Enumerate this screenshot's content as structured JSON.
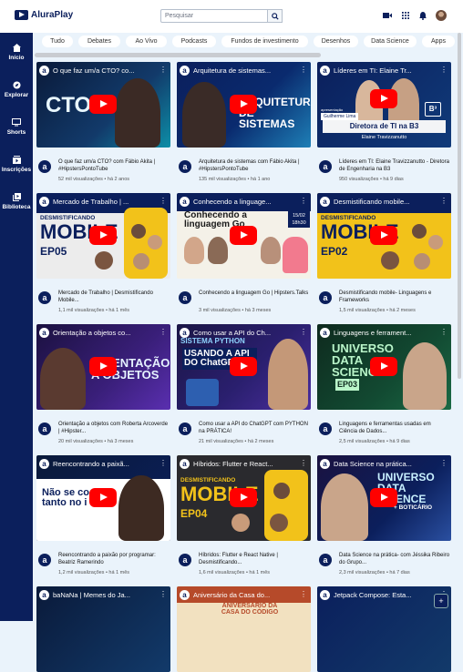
{
  "header": {
    "logo": "AluraPlay",
    "search_placeholder": "Pesquisar"
  },
  "sidebar": {
    "items": [
      {
        "label": "Início",
        "icon": "home-icon"
      },
      {
        "label": "Explorar",
        "icon": "compass-icon"
      },
      {
        "label": "Shorts",
        "icon": "monitor-icon"
      },
      {
        "label": "Inscrições",
        "icon": "subscriptions-icon"
      },
      {
        "label": "Biblioteca",
        "icon": "library-icon"
      }
    ]
  },
  "chips": [
    "Tudo",
    "Debates",
    "Ao Vivo",
    "Podcasts",
    "Fundos de investimento",
    "Desenhos",
    "Data Science",
    "Apps"
  ],
  "videos": [
    {
      "thumb_title": "O que faz um/a CTO? co...",
      "title": "O que faz um/a CTO? com Fábio Akita | #HipstersPontoTube",
      "stats": "52 mil visualizações • há 2 anos",
      "big": "CTO?"
    },
    {
      "thumb_title": "Arquitetura de sistemas...",
      "title": "Arquitetura de sistemas com Fábio Akita | #HipstersPontoTube",
      "stats": "135 mil visualizações • há 1 ano",
      "big": "ARQUITETURA DE SISTEMAS"
    },
    {
      "thumb_title": "Líderes em TI: Elaine Tr...",
      "title": "Líderes em TI: Elaine Travizzanutto - Diretora de Engenharia na B3",
      "stats": "950 visualizações • há 9 dias",
      "big": "Diretora de TI na B3",
      "extra": "Elaine Travizzanutto",
      "extra2": "Guilherme Lima",
      "extra3": "apresentação"
    },
    {
      "thumb_title": "Mercado de Trabalho | ...",
      "title": "Mercado de Trabalho | Desmistificando Mobile...",
      "stats": "1,1 mil visualizações • há 1 mês",
      "big": "MOBILE",
      "ep": "EP05",
      "extra": "DESMISTIFICANDO"
    },
    {
      "thumb_title": "Conhecendo a linguage...",
      "title": "Conhecendo a linguagem Go | Hipsters.Talks",
      "stats": "3 mil visualizações • há 3 meses",
      "big": "Conhecendo a linguagem Go",
      "extra": "15/02",
      "extra2": "18h30"
    },
    {
      "thumb_title": "Desmistificando mobile...",
      "title": "Desmistificando mobile- Linguagens e Frameworks",
      "stats": "1,5 mil visualizações • há 2 meses",
      "big": "MOBILE",
      "ep": "EP02",
      "extra": "DESMISTIFICANDO"
    },
    {
      "thumb_title": "Orientação a objetos co...",
      "title": "Orientação a objetos com Roberta Arcoverde | #Hipster...",
      "stats": "20 mil visualizações • há 3 meses",
      "big": "ORIENTAÇÃO A OBJETOS"
    },
    {
      "thumb_title": "Como usar a API do Ch...",
      "title": "Como usar a API do ChatGPT com PYTHON na PRÁTICA!",
      "stats": "21 mil visualizações • há 2 meses",
      "big": "USANDO A API DO ChatGPT",
      "extra": "SISTEMA PYTHON"
    },
    {
      "thumb_title": "Linguagens e ferrament...",
      "title": "Linguagens e ferramentas usadas em Ciência de Dados...",
      "stats": "2,5 mil visualizações • há 9 dias",
      "big": "UNIVERSO DATA SCIENCE",
      "ep": "EP03"
    },
    {
      "thumb_title": "Reencontrando a paixã...",
      "title": "Reencontrando a paixão por programar: Beatriz Ramerindo",
      "stats": "1,2 mil visualizações • há 1 mês",
      "big": "Não se co tanto no i"
    },
    {
      "thumb_title": "Híbridos: Flutter e React...",
      "title": "Híbridos: Flutter e React Native | Desmistificando...",
      "stats": "1,6 mil visualizações • há 1 mês",
      "big": "MOBILE",
      "ep": "EP04",
      "extra": "DESMISTIFICANDO"
    },
    {
      "thumb_title": "Data Science na prática...",
      "title": "Data Science na prática- com Jéssika Ribeiro do Grupo...",
      "stats": "2,3 mil visualizações • há 7 dias",
      "big": "UNIVERSO DATA SCIENCE",
      "extra": "+ BOTICÁRIO"
    },
    {
      "thumb_title": "baNaNa | Memes do Ja..."
    },
    {
      "thumb_title": "Aniversário da Casa do...",
      "big": "ANIVERSÁRIO DA CASA DO CÓDIGO"
    },
    {
      "thumb_title": "Jetpack Compose: Esta..."
    }
  ],
  "colors": {
    "brand": "#0b1f5c",
    "background": "#eaf3fb",
    "play": "#ff0000"
  }
}
